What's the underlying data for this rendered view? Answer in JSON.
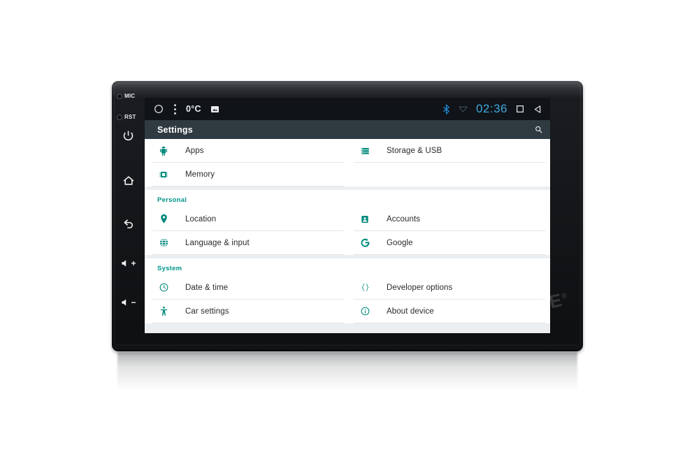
{
  "device": {
    "brand_watermark": "MEKEDE",
    "watermark_mark": "®",
    "bezel_buttons": [
      {
        "name": "mic",
        "label": "MIC"
      },
      {
        "name": "reset",
        "label": "RST"
      },
      {
        "name": "power",
        "label": ""
      },
      {
        "name": "home",
        "label": ""
      },
      {
        "name": "back",
        "label": ""
      },
      {
        "name": "volume-up",
        "label": "+"
      },
      {
        "name": "volume-down",
        "label": "−"
      }
    ]
  },
  "statusbar": {
    "circle_icon": "circle-outline-icon",
    "menu_icon": "overflow-menu-icon",
    "temperature": "0°C",
    "image_icon": "image-icon",
    "bluetooth_icon": "bluetooth-icon",
    "wifi_icon": "wifi-off-icon",
    "time": "02:36",
    "recents_icon": "recents-square-icon",
    "back_icon": "back-triangle-icon"
  },
  "titlebar": {
    "title": "Settings",
    "search_icon": "search-icon"
  },
  "settings": {
    "sections": [
      {
        "header": "",
        "rows": [
          {
            "left": {
              "label": "Apps",
              "icon": "android-apps-icon"
            },
            "right": {
              "label": "Storage & USB",
              "icon": "storage-icon"
            }
          },
          {
            "left": {
              "label": "Memory",
              "icon": "memory-icon"
            },
            "right": {
              "label": "",
              "icon": ""
            }
          }
        ]
      },
      {
        "header": "Personal",
        "rows": [
          {
            "left": {
              "label": "Location",
              "icon": "location-pin-icon"
            },
            "right": {
              "label": "Accounts",
              "icon": "accounts-icon"
            }
          },
          {
            "left": {
              "label": "Language & input",
              "icon": "globe-icon"
            },
            "right": {
              "label": "Google",
              "icon": "google-g-icon"
            }
          }
        ]
      },
      {
        "header": "System",
        "rows": [
          {
            "left": {
              "label": "Date & time",
              "icon": "clock-icon"
            },
            "right": {
              "label": "Developer options",
              "icon": "braces-icon"
            }
          },
          {
            "left": {
              "label": "Car settings",
              "icon": "accessibility-icon"
            },
            "right": {
              "label": "About device",
              "icon": "info-icon"
            }
          }
        ]
      }
    ]
  },
  "colors": {
    "accent_teal": "#00897b",
    "section_header_teal": "#009688",
    "clock_blue": "#3fa9dd",
    "titlebar_bg": "#2f3a41",
    "statusbar_bg": "#101317",
    "content_bg": "#eceff1"
  }
}
